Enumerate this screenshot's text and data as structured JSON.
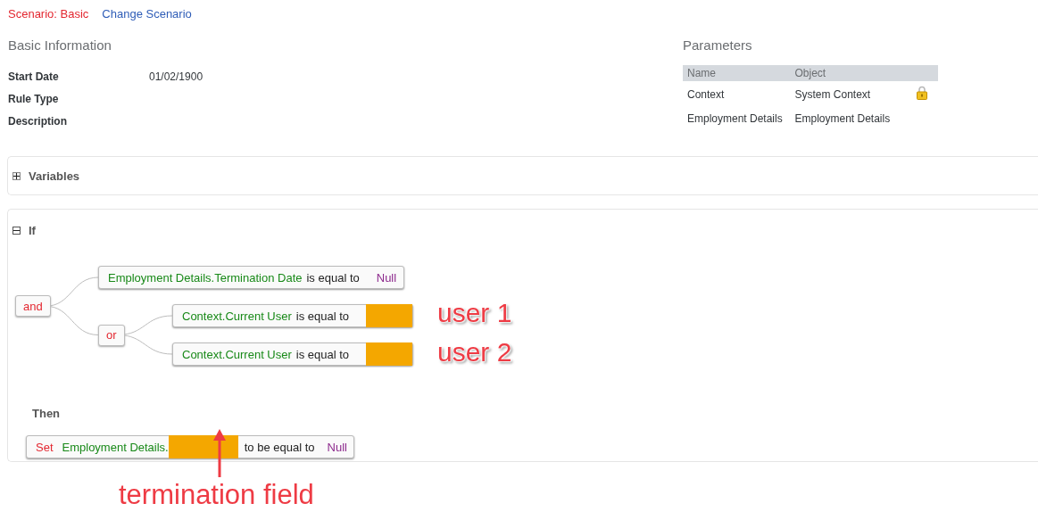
{
  "scenario": {
    "label": "Scenario: Basic",
    "link": "Change Scenario"
  },
  "basic_information": {
    "title": "Basic Information",
    "fields": [
      {
        "label": "Start Date",
        "value": "01/02/1900"
      },
      {
        "label": "Rule Type"
      },
      {
        "label": "Description"
      }
    ]
  },
  "parameters": {
    "title": "Parameters",
    "columns": [
      "Name",
      "Object"
    ],
    "rows": [
      {
        "name": "Context",
        "object": "System Context",
        "locked": true
      },
      {
        "name": "Employment Details",
        "object": "Employment Details",
        "locked": false
      }
    ]
  },
  "variables": {
    "title": "Variables",
    "expanded": false
  },
  "if": {
    "title": "If",
    "expanded": true,
    "tree": {
      "kind": "group",
      "operator": "and",
      "children": [
        {
          "kind": "condition",
          "field": "Employment Details.Termination Date",
          "operator": "is equal to",
          "value": "Null"
        },
        {
          "kind": "group",
          "operator": "or",
          "children": [
            {
              "kind": "condition",
              "field": "Context.Current User",
              "operator": "is equal to",
              "redacted": true
            },
            {
              "kind": "condition",
              "field": "Context.Current User",
              "operator": "is equal to",
              "redacted": true
            }
          ]
        }
      ]
    }
  },
  "then": {
    "title": "Then",
    "action": {
      "verb": "Set",
      "field": "Employment Details.",
      "redacted": true,
      "operator": "to be equal to",
      "value": "Null"
    }
  },
  "annotations": [
    {
      "kind": "label",
      "text": "user 1"
    },
    {
      "kind": "label",
      "text": "user 2"
    },
    {
      "kind": "arrow-label",
      "text": "termination field"
    }
  ]
}
